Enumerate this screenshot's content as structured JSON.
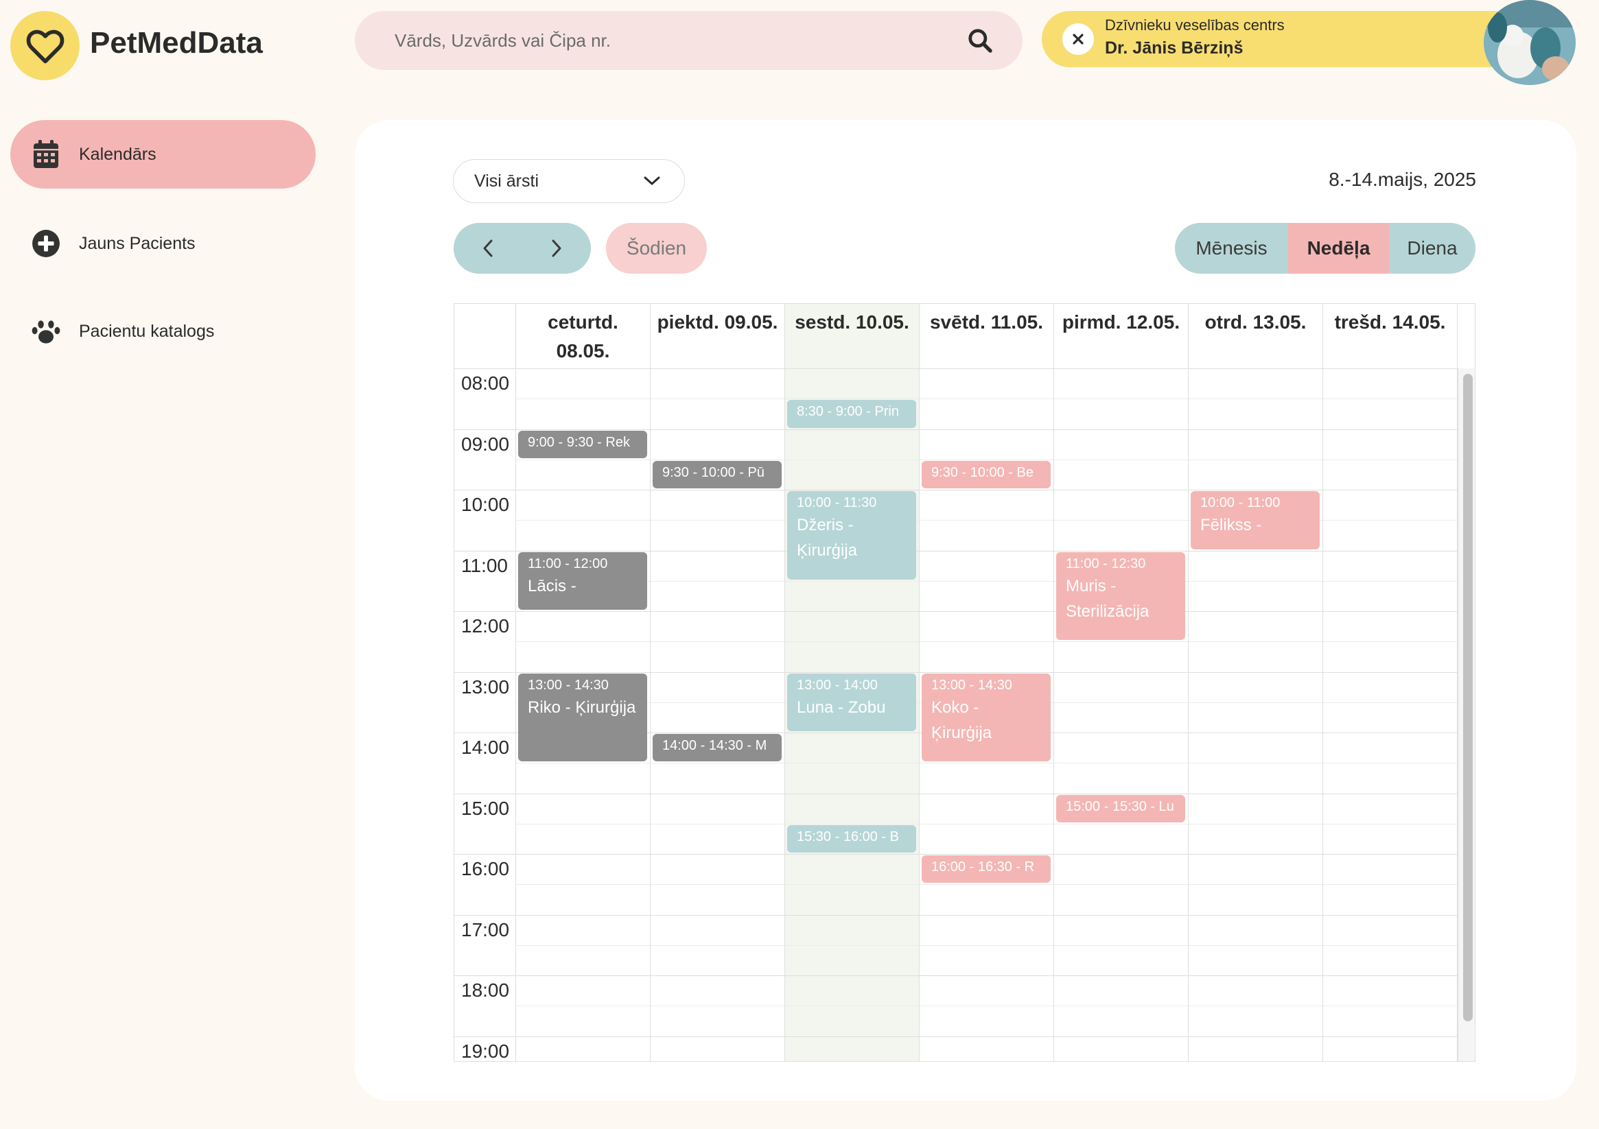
{
  "app": {
    "name": "PetMedData"
  },
  "search": {
    "placeholder": "Vārds, Uzvārds vai Čipa nr."
  },
  "user": {
    "clinic": "Dzīvnieku veselības centrs",
    "name": "Dr. Jānis Bērziņš"
  },
  "sidebar": {
    "items": [
      {
        "label": "Kalendārs",
        "icon": "calendar-icon",
        "active": true
      },
      {
        "label": "Jauns Pacients",
        "icon": "plus-circle-icon",
        "active": false
      },
      {
        "label": "Pacientu katalogs",
        "icon": "paw-icon",
        "active": false
      }
    ]
  },
  "calendar": {
    "doctor_filter": "Visi ārsti",
    "date_range": "8.-14.maijs, 2025",
    "today_label": "Šodien",
    "views": {
      "month": "Mēnesis",
      "week": "Nedēļa",
      "day": "Diena",
      "active": "week"
    },
    "days": [
      {
        "line1": "ceturtd.",
        "line2": "08.05."
      },
      {
        "line1": "piektd. 09.05.",
        "line2": ""
      },
      {
        "line1": "sestd. 10.05.",
        "line2": ""
      },
      {
        "line1": "svētd. 11.05.",
        "line2": ""
      },
      {
        "line1": "pirmd. 12.05.",
        "line2": ""
      },
      {
        "line1": "otrd. 13.05.",
        "line2": ""
      },
      {
        "line1": "trešd. 14.05.",
        "line2": ""
      }
    ],
    "hours": [
      "08:00",
      "09:00",
      "10:00",
      "11:00",
      "12:00",
      "13:00",
      "14:00",
      "15:00",
      "16:00",
      "17:00",
      "18:00",
      "19:00"
    ],
    "events": [
      {
        "day": 0,
        "start": 9.0,
        "end": 9.5,
        "time": "9:00 - 9:30 - Rek",
        "desc": "",
        "color": "gray"
      },
      {
        "day": 0,
        "start": 11.0,
        "end": 12.0,
        "time": "11:00 - 12:00",
        "desc": "Lācis -",
        "color": "gray"
      },
      {
        "day": 0,
        "start": 13.0,
        "end": 14.5,
        "time": "13:00 - 14:30",
        "desc": "Riko - Ķirurģija",
        "color": "gray"
      },
      {
        "day": 1,
        "start": 9.5,
        "end": 10.0,
        "time": "9:30 - 10:00 - Pū",
        "desc": "",
        "color": "gray"
      },
      {
        "day": 1,
        "start": 14.0,
        "end": 14.5,
        "time": "14:00 - 14:30 - M",
        "desc": "",
        "color": "gray"
      },
      {
        "day": 2,
        "start": 8.5,
        "end": 9.0,
        "time": "8:30 - 9:00 - Prin",
        "desc": "",
        "color": "teal"
      },
      {
        "day": 2,
        "start": 10.0,
        "end": 11.5,
        "time": "10:00 - 11:30",
        "desc": "Džeris - Ķirurģija",
        "color": "teal"
      },
      {
        "day": 2,
        "start": 13.0,
        "end": 14.0,
        "time": "13:00 - 14:00",
        "desc": "Luna - Zobu",
        "color": "teal"
      },
      {
        "day": 2,
        "start": 15.5,
        "end": 16.0,
        "time": "15:30 - 16:00 - B",
        "desc": "",
        "color": "teal"
      },
      {
        "day": 3,
        "start": 9.5,
        "end": 10.0,
        "time": "9:30 - 10:00 - Be",
        "desc": "",
        "color": "pink"
      },
      {
        "day": 3,
        "start": 13.0,
        "end": 14.5,
        "time": "13:00 - 14:30",
        "desc": "Koko - Ķirurģija",
        "color": "pink"
      },
      {
        "day": 3,
        "start": 16.0,
        "end": 16.5,
        "time": "16:00 - 16:30 - R",
        "desc": "",
        "color": "pink"
      },
      {
        "day": 4,
        "start": 11.0,
        "end": 12.5,
        "time": "11:00 - 12:30",
        "desc": "Muris - Sterilizācija",
        "color": "pink"
      },
      {
        "day": 4,
        "start": 15.0,
        "end": 15.5,
        "time": "15:00 - 15:30 - Lu",
        "desc": "",
        "color": "pink"
      },
      {
        "day": 5,
        "start": 10.0,
        "end": 11.0,
        "time": "10:00 - 11:00",
        "desc": "Fēlikss -",
        "color": "pink"
      }
    ]
  }
}
